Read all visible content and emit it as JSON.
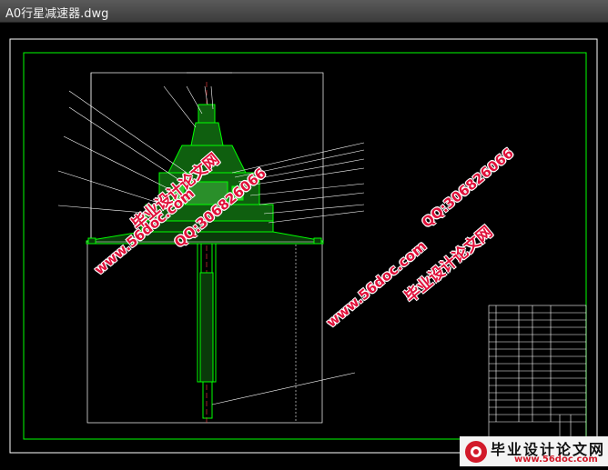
{
  "window": {
    "title": "A0行星减速器.dwg"
  },
  "watermarks": {
    "site": "www.56doc.com",
    "qq": "QQ:306826066",
    "brand": "毕业设计论文网"
  },
  "logo": {
    "brand": "毕业设计论文网",
    "url": "www.56doc.com"
  },
  "colors": {
    "background": "#000000",
    "drawing_line": "#00ff00",
    "frame_line": "#ffffff",
    "watermark": "#e0103a"
  }
}
